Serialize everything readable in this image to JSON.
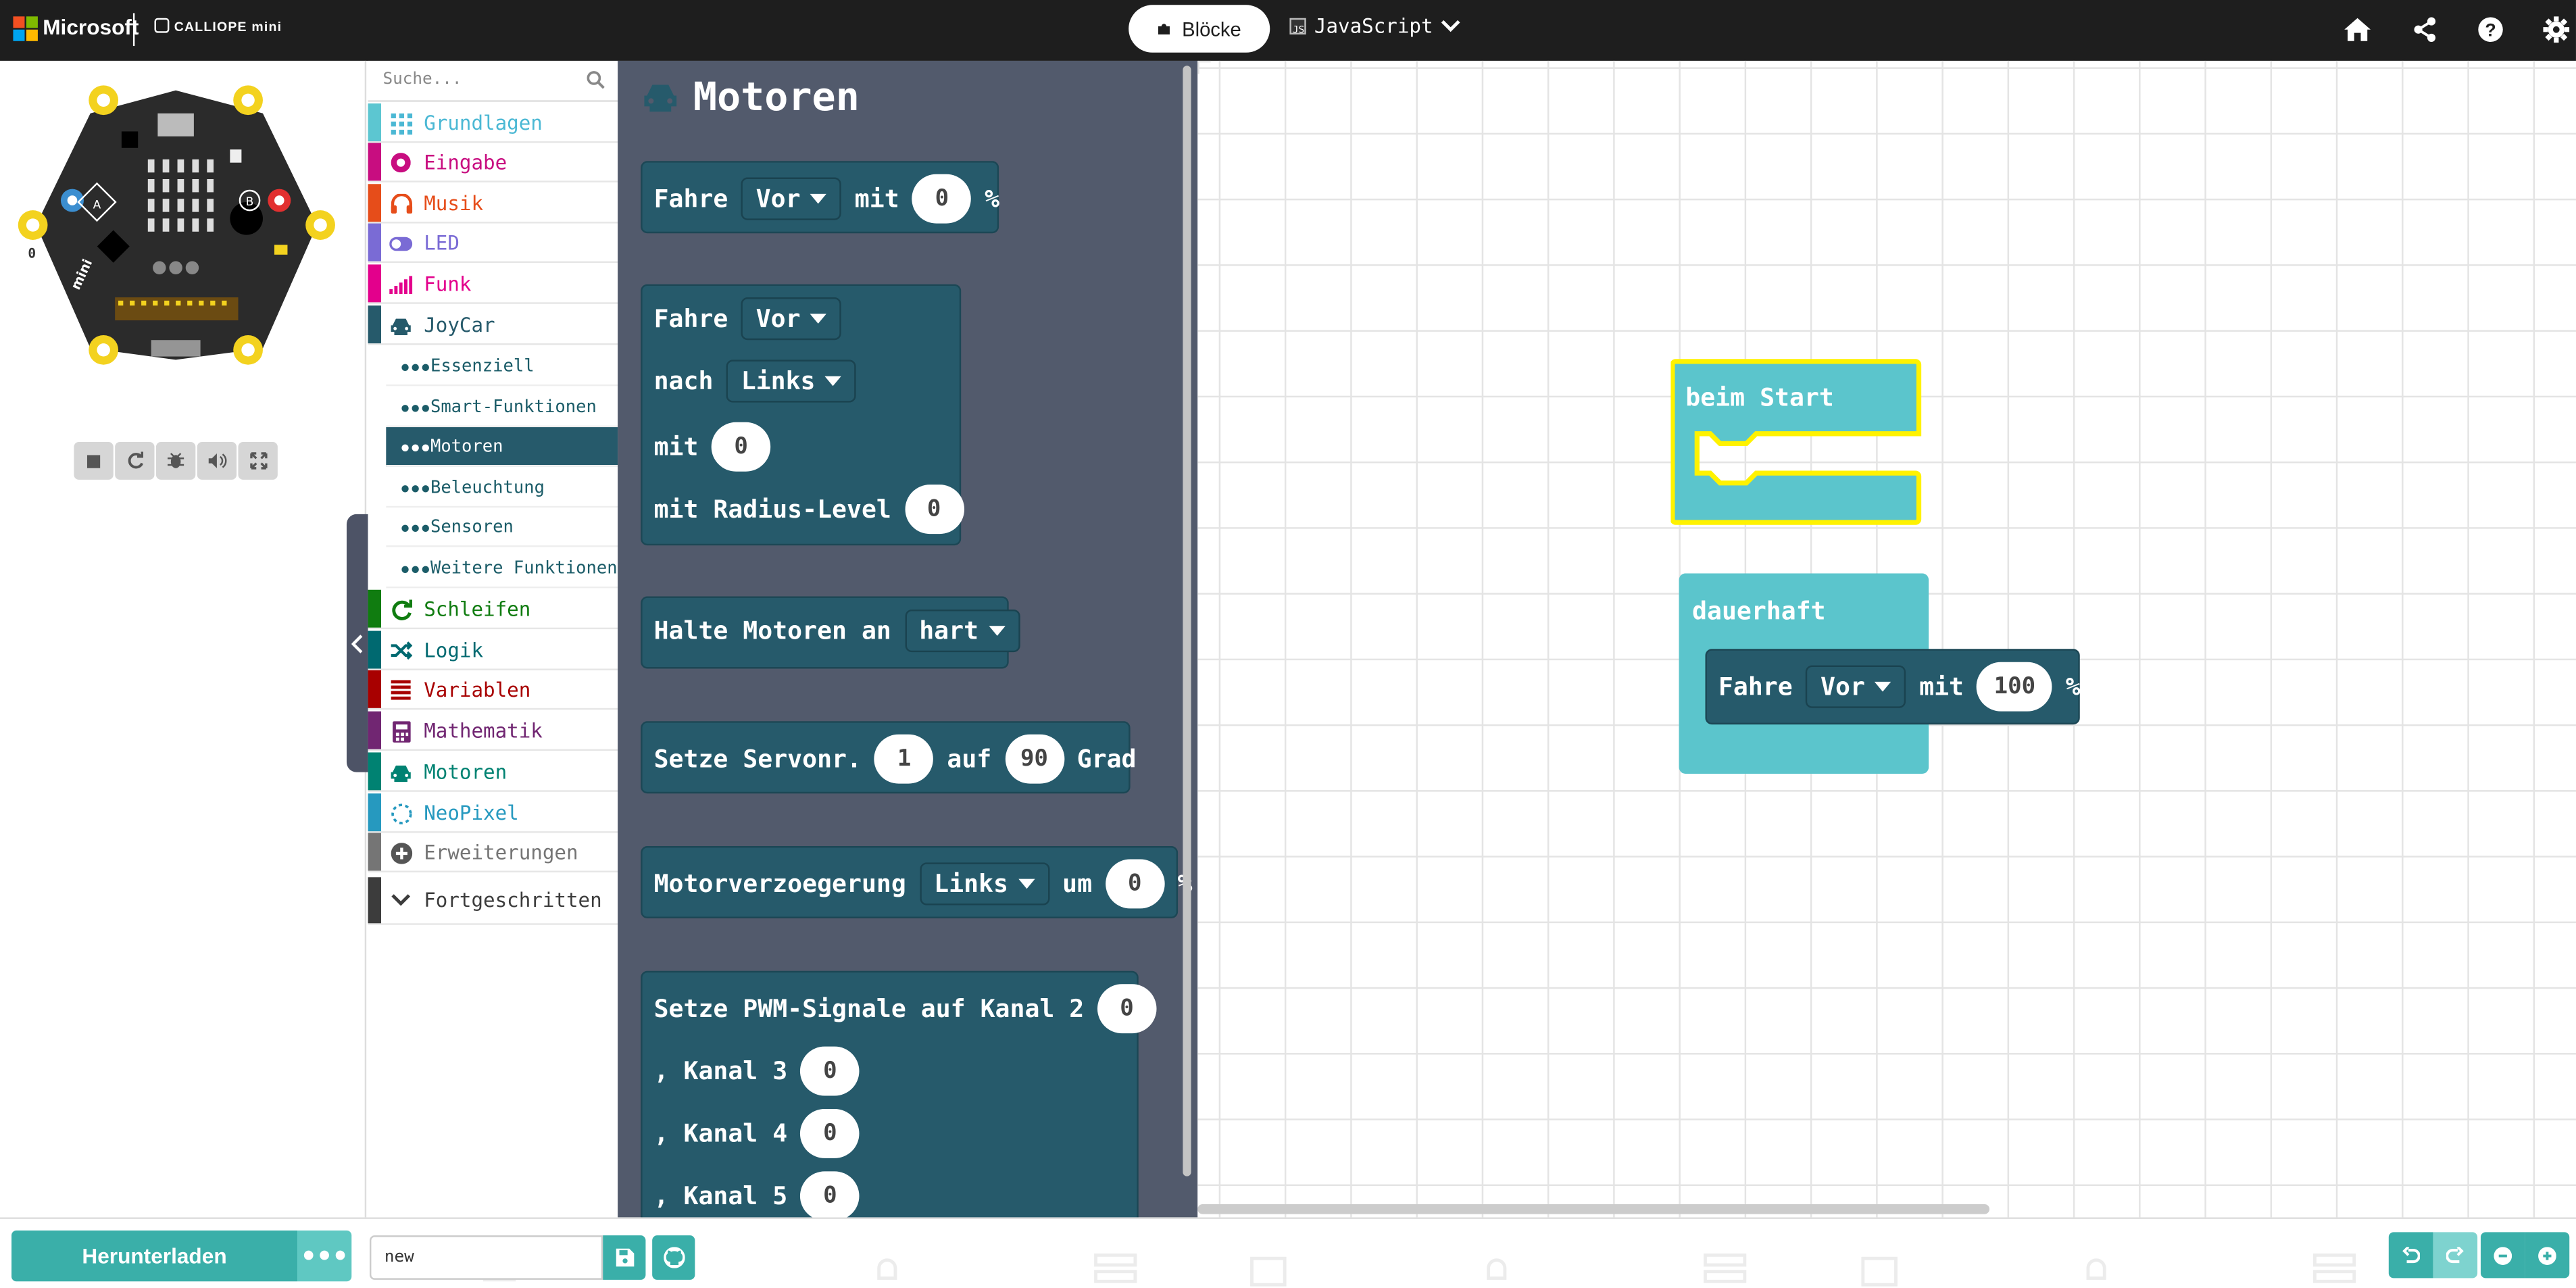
{
  "header": {
    "brand": "Microsoft",
    "product": "CALLIOPE mini",
    "tab_blocks": "Blöcke",
    "tab_js": "JavaScript",
    "icons": [
      "home-icon",
      "share-icon",
      "help-icon",
      "settings-icon"
    ]
  },
  "simulator": {
    "pin_label": "0",
    "controls": [
      "stop-icon",
      "restart-icon",
      "debug-icon",
      "sound-icon",
      "fullscreen-icon"
    ]
  },
  "toolbox": {
    "search_placeholder": "Suche...",
    "categories": [
      {
        "label": "Grundlagen",
        "color": "#1e90ff"
      },
      {
        "label": "Eingabe",
        "color": "#d400d4"
      },
      {
        "label": "Musik",
        "color": "#e63022"
      },
      {
        "label": "LED",
        "color": "#5c2d91"
      },
      {
        "label": "Funk",
        "color": "#e3008c"
      },
      {
        "label": "JoyCar",
        "color": "#265a6b"
      }
    ],
    "subcategories": [
      "Essenziell",
      "Smart-Funktionen",
      "Motoren",
      "Beleuchtung",
      "Sensoren",
      "Weitere Funktionen"
    ],
    "selected_sub": "Motoren",
    "categories2": [
      {
        "label": "Schleifen",
        "color": "#00aa00"
      },
      {
        "label": "Logik",
        "color": "#00a4a6"
      },
      {
        "label": "Variablen",
        "color": "#dc143c"
      },
      {
        "label": "Mathematik",
        "color": "#9400d3"
      },
      {
        "label": "Motoren",
        "color": "#008272"
      },
      {
        "label": "NeoPixel",
        "color": "#2699bf"
      },
      {
        "label": "Erweiterungen",
        "color": "#757575"
      },
      {
        "label": "Fortgeschritten",
        "color": "#3c3c3c"
      }
    ]
  },
  "flyout": {
    "title": "Motoren",
    "b1": {
      "fahre": "Fahre",
      "dir": "Vor",
      "mit": "mit",
      "val": "0",
      "pct": "%"
    },
    "b2": {
      "fahre": "Fahre",
      "dir": "Vor",
      "nach": "nach",
      "side": "Links",
      "mit": "mit",
      "val": "0",
      "radius": "mit Radius-Level",
      "radius_val": "0"
    },
    "b3": {
      "text": "Halte Motoren an",
      "mode": "hart"
    },
    "b4": {
      "text": "Setze Servonr.",
      "servo": "1",
      "auf": "auf",
      "deg": "90",
      "grad": "Grad"
    },
    "b5": {
      "text": "Motorverzoegerung",
      "side": "Links",
      "um": "um",
      "val": "0",
      "pct": "%"
    },
    "b6": {
      "text": "Setze PWM-Signale auf Kanal 2",
      "k2": "0",
      "k3_label": ", Kanal 3",
      "k3": "0",
      "k4_label": ", Kanal 4",
      "k4": "0",
      "k5_label": ", Kanal 5",
      "k5": "0"
    }
  },
  "workspace": {
    "on_start": "beim Start",
    "forever": "dauerhaft",
    "drive": {
      "fahre": "Fahre",
      "dir": "Vor",
      "mit": "mit",
      "val": "100",
      "pct": "%"
    }
  },
  "footer": {
    "download": "Herunterladen",
    "more": "•••",
    "project_name": "new"
  }
}
